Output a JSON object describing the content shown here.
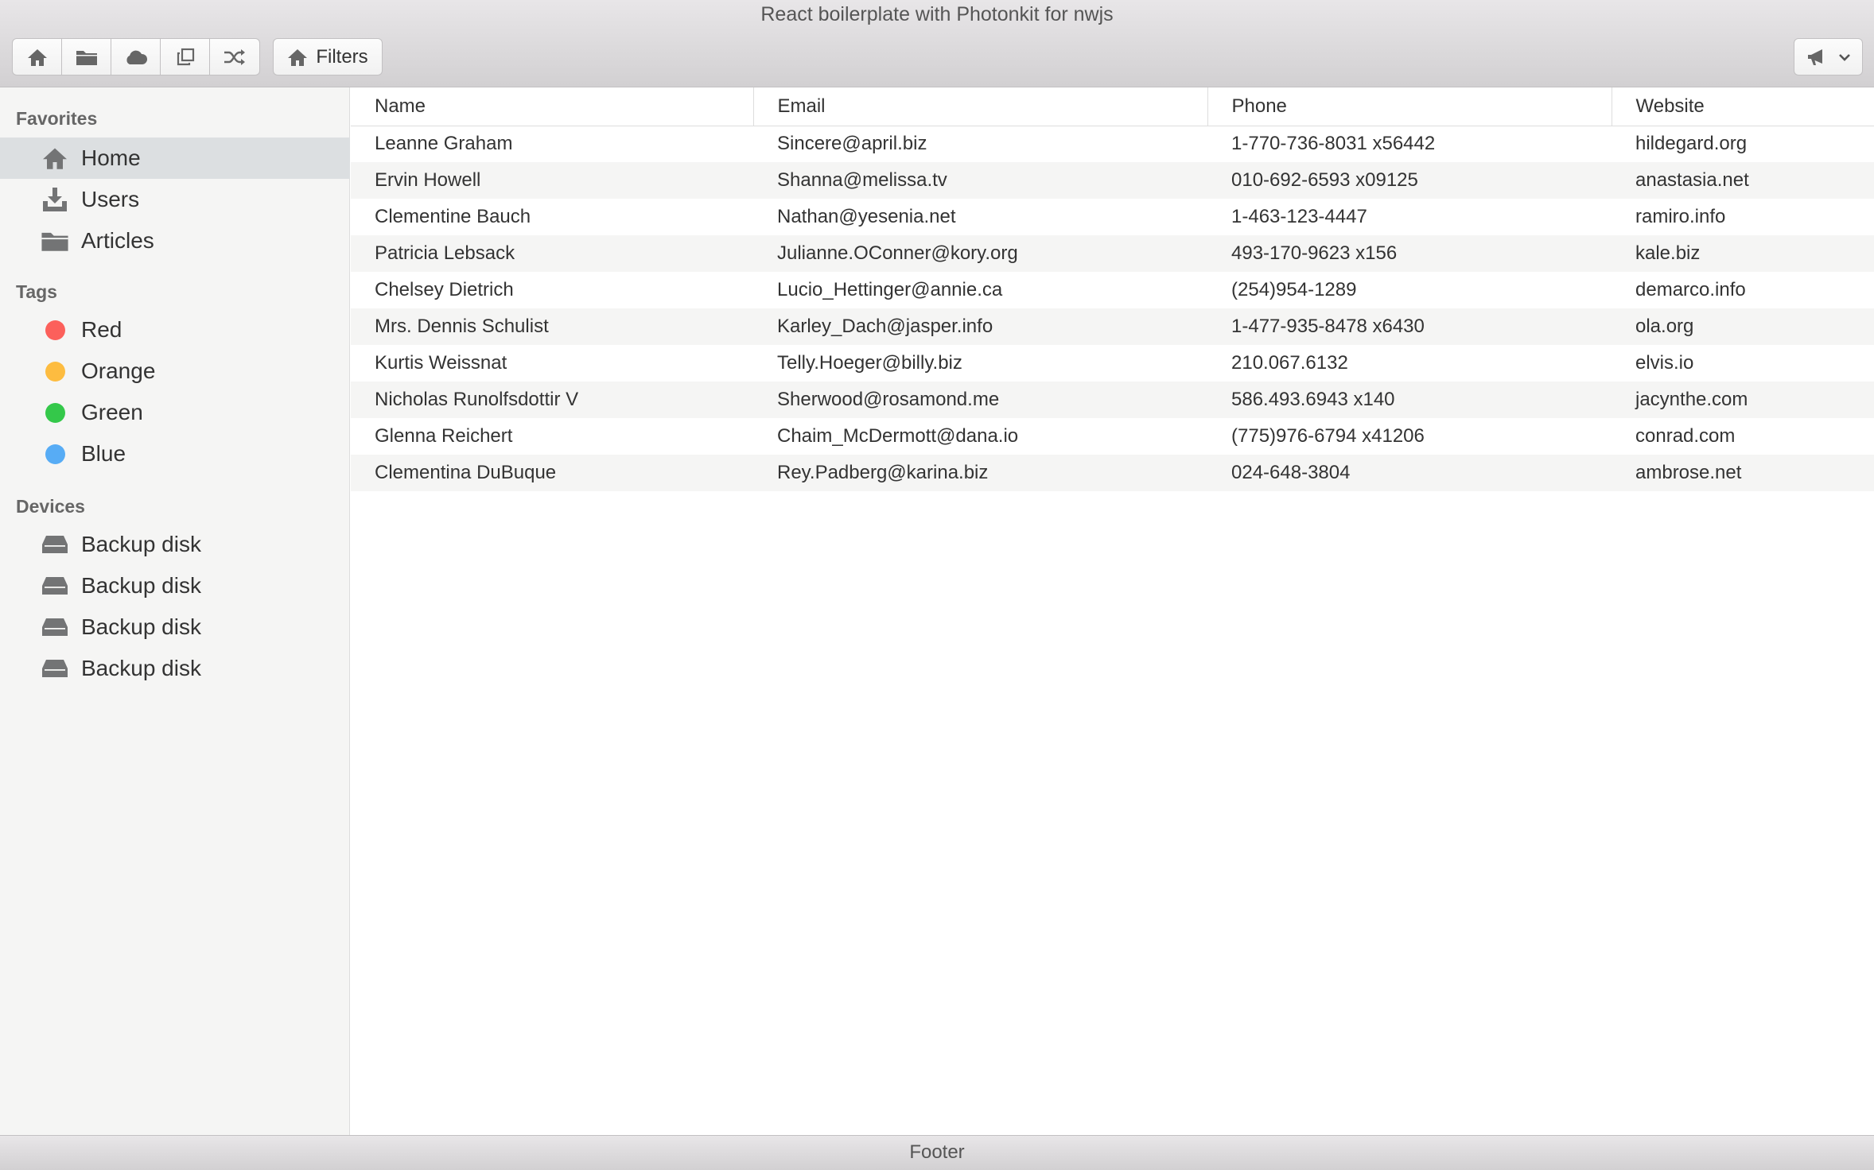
{
  "window": {
    "title": "React boilerplate with Photonkit for nwjs"
  },
  "toolbar": {
    "buttons": [
      {
        "icon": "home-icon"
      },
      {
        "icon": "folder-icon"
      },
      {
        "icon": "cloud-icon"
      },
      {
        "icon": "popup-icon"
      },
      {
        "icon": "shuffle-icon"
      }
    ],
    "filters_label": "Filters",
    "filters_icon": "home-icon",
    "dropdown_icon": "megaphone-icon"
  },
  "sidebar": {
    "favorites_title": "Favorites",
    "favorites": [
      {
        "label": "Home",
        "icon": "home-icon",
        "active": true
      },
      {
        "label": "Users",
        "icon": "download-icon",
        "active": false
      },
      {
        "label": "Articles",
        "icon": "folder-icon",
        "active": false
      }
    ],
    "tags_title": "Tags",
    "tags": [
      {
        "label": "Red",
        "color": "#fc605b"
      },
      {
        "label": "Orange",
        "color": "#fdbc40"
      },
      {
        "label": "Green",
        "color": "#34c84a"
      },
      {
        "label": "Blue",
        "color": "#57acf5"
      }
    ],
    "devices_title": "Devices",
    "devices": [
      {
        "label": "Backup disk",
        "icon": "drive-icon"
      },
      {
        "label": "Backup disk",
        "icon": "drive-icon"
      },
      {
        "label": "Backup disk",
        "icon": "drive-icon"
      },
      {
        "label": "Backup disk",
        "icon": "drive-icon"
      }
    ]
  },
  "table": {
    "columns": [
      "Name",
      "Email",
      "Phone",
      "Website"
    ],
    "rows": [
      [
        "Leanne Graham",
        "Sincere@april.biz",
        "1-770-736-8031 x56442",
        "hildegard.org"
      ],
      [
        "Ervin Howell",
        "Shanna@melissa.tv",
        "010-692-6593 x09125",
        "anastasia.net"
      ],
      [
        "Clementine Bauch",
        "Nathan@yesenia.net",
        "1-463-123-4447",
        "ramiro.info"
      ],
      [
        "Patricia Lebsack",
        "Julianne.OConner@kory.org",
        "493-170-9623 x156",
        "kale.biz"
      ],
      [
        "Chelsey Dietrich",
        "Lucio_Hettinger@annie.ca",
        "(254)954-1289",
        "demarco.info"
      ],
      [
        "Mrs. Dennis Schulist",
        "Karley_Dach@jasper.info",
        "1-477-935-8478 x6430",
        "ola.org"
      ],
      [
        "Kurtis Weissnat",
        "Telly.Hoeger@billy.biz",
        "210.067.6132",
        "elvis.io"
      ],
      [
        "Nicholas Runolfsdottir V",
        "Sherwood@rosamond.me",
        "586.493.6943 x140",
        "jacynthe.com"
      ],
      [
        "Glenna Reichert",
        "Chaim_McDermott@dana.io",
        "(775)976-6794 x41206",
        "conrad.com"
      ],
      [
        "Clementina DuBuque",
        "Rey.Padberg@karina.biz",
        "024-648-3804",
        "ambrose.net"
      ]
    ]
  },
  "footer": {
    "text": "Footer"
  }
}
